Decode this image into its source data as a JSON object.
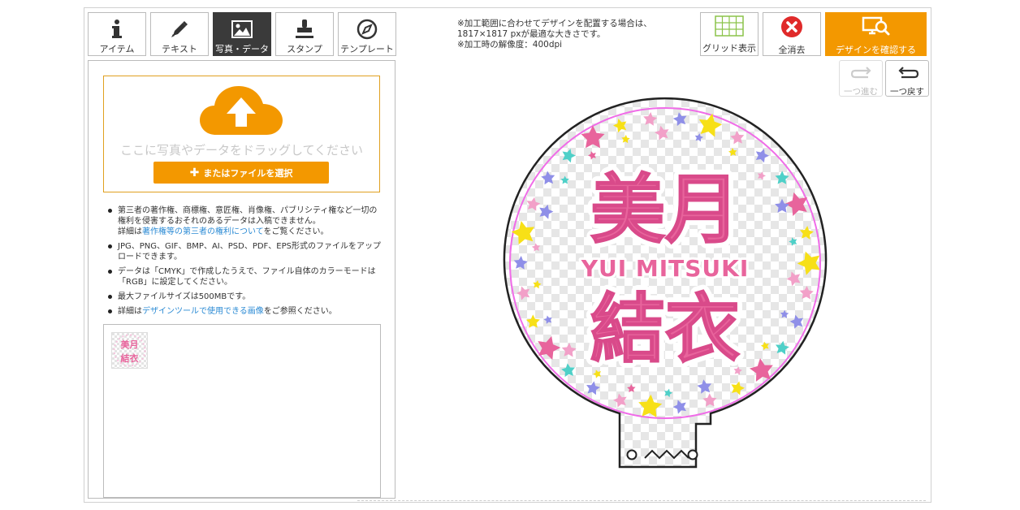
{
  "tabs": [
    {
      "label": "アイテム",
      "icon": "info-icon"
    },
    {
      "label": "テキスト",
      "icon": "pen-icon"
    },
    {
      "label": "写真・データ",
      "icon": "image-icon"
    },
    {
      "label": "スタンプ",
      "icon": "stamp-icon"
    },
    {
      "label": "テンプレート",
      "icon": "compass-icon"
    }
  ],
  "active_tab": "写真・データ",
  "info": {
    "line1": "※加工範囲に合わせてデザインを配置する場合は、",
    "line2": "1817×1817 pxが最適な大きさです。",
    "line3": "※加工時の解像度：400dpi"
  },
  "toolbar": {
    "grid_label": "グリッド表示",
    "clear_label": "全消去",
    "confirm_label": "デザインを確認する",
    "redo_label": "一つ進む",
    "undo_label": "一つ戻す"
  },
  "upload": {
    "drop_hint": "ここに写真やデータをドラッグしてください",
    "choose_label": "またはファイルを選択"
  },
  "notes": {
    "n1": "第三者の著作権、商標権、意匠権、肖像権、パブリシティ権など一切の権利を侵害するおそれのあるデータは入稿できません。",
    "n1b_prefix": "詳細は",
    "n1b_link": "著作権等の第三者の権利について",
    "n1b_suffix": "をご覧ください。",
    "n2": "JPG、PNG、GIF、BMP、AI、PSD、PDF、EPS形式のファイルをアップロードできます。",
    "n3": "データは「CMYK」で作成したうえで、ファイル自体のカラーモードは「RGB」に設定してください。",
    "n4": "最大ファイルサイズは500MBです。",
    "n5_prefix": "詳細は",
    "n5_link": "デザインツールで使用できる画像",
    "n5_suffix": "をご参照ください。"
  },
  "design": {
    "top_text": "美月",
    "middle_text": "YUI MITSUKI",
    "bottom_text": "結衣",
    "colors": {
      "pink": "#e8649c",
      "accent": "#f39800",
      "outline": "#f06ce8"
    }
  }
}
